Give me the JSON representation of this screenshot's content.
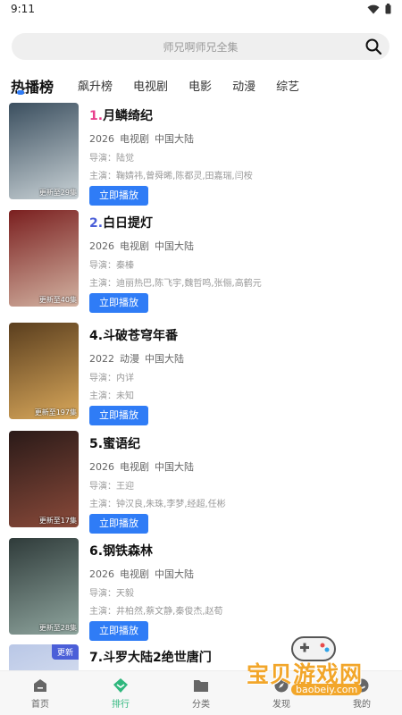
{
  "status": {
    "time": "9:11"
  },
  "search": {
    "placeholder": "师兄啊师兄全集"
  },
  "tabs": [
    {
      "label": "热播榜",
      "active": true
    },
    {
      "label": "飙升榜"
    },
    {
      "label": "电视剧"
    },
    {
      "label": "电影"
    },
    {
      "label": "动漫"
    },
    {
      "label": "综艺"
    }
  ],
  "items": [
    {
      "rank": "1.",
      "rank_color": "#e83f8c",
      "title": "月鳞绮纪",
      "year": "2026",
      "type": "电视剧",
      "region": "中国大陆",
      "director": "导演：陆觉",
      "cast": "主演：鞠婧祎,曾舜晞,陈都灵,田嘉瑞,闫桉",
      "badge": "更新至29集",
      "play": "立即播放",
      "poster_colors": [
        "#3b4f5f",
        "#c9d2d6"
      ]
    },
    {
      "rank": "2.",
      "rank_color": "#4b5fd8",
      "title": "白日提灯",
      "year": "2026",
      "type": "电视剧",
      "region": "中国大陆",
      "director": "导演：秦榛",
      "cast": "主演：迪丽热巴,陈飞宇,魏哲鸣,张俪,高鹤元",
      "badge": "更新至40集",
      "play": "立即播放",
      "poster_colors": [
        "#7a1f1f",
        "#d3b3a2"
      ]
    },
    {
      "rank": "4.",
      "rank_color": "#111111",
      "title": "斗破苍穹年番",
      "year": "2022",
      "type": "动漫",
      "region": "中国大陆",
      "director": "导演：内详",
      "cast": "主演：未知",
      "badge": "更新至197集",
      "play": "立即播放",
      "poster_colors": [
        "#5a3e1e",
        "#d9a85b"
      ]
    },
    {
      "rank": "5.",
      "rank_color": "#111111",
      "title": "蜜语纪",
      "year": "2026",
      "type": "电视剧",
      "region": "中国大陆",
      "director": "导演：王迎",
      "cast": "主演：钟汉良,朱珠,李梦,经超,任彬",
      "badge": "更新至17集",
      "play": "立即播放",
      "poster_colors": [
        "#2a1a18",
        "#8a4a3a"
      ]
    },
    {
      "rank": "6.",
      "rank_color": "#111111",
      "title": "钢铁森林",
      "year": "2026",
      "type": "电视剧",
      "region": "中国大陆",
      "director": "导演：天毅",
      "cast": "主演：井柏然,蔡文静,秦俊杰,赵荀",
      "badge": "更新至28集",
      "play": "立即播放",
      "poster_colors": [
        "#2f3b3a",
        "#8fa59e"
      ]
    },
    {
      "rank": "7.",
      "rank_color": "#111111",
      "title": "斗罗大陆2绝世唐门",
      "corner": "更新",
      "poster_colors": [
        "#b9c7e6",
        "#eef1f8"
      ]
    }
  ],
  "nav": [
    {
      "label": "首页",
      "icon": "home-icon"
    },
    {
      "label": "排行",
      "icon": "ranking-icon",
      "active": true
    },
    {
      "label": "分类",
      "icon": "folder-icon"
    },
    {
      "label": "发现",
      "icon": "discover-icon"
    },
    {
      "label": "我的",
      "icon": "profile-icon"
    }
  ],
  "watermark": {
    "text": "宝贝游戏网",
    "url": "baobeiy.com"
  }
}
